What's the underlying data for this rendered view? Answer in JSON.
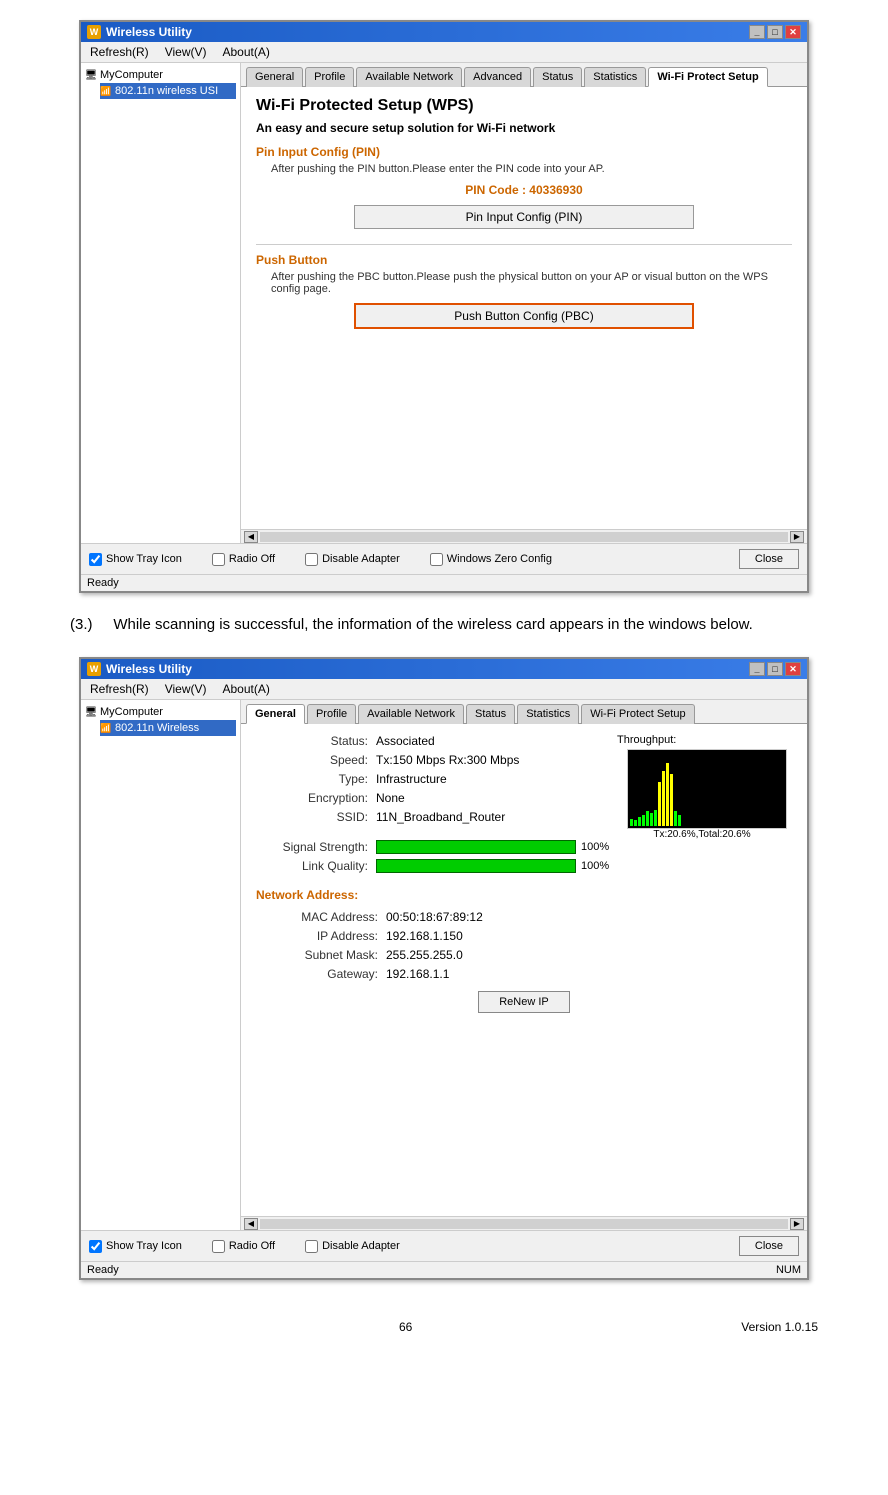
{
  "window1": {
    "title": "Wireless Utility",
    "menubar": [
      "Refresh(R)",
      "View(V)",
      "About(A)"
    ],
    "sidebar": {
      "items": [
        {
          "label": "MyComputer",
          "type": "computer"
        },
        {
          "label": "802.11n wireless USI",
          "type": "wireless"
        }
      ]
    },
    "tabs": [
      {
        "label": "General",
        "active": false
      },
      {
        "label": "Profile",
        "active": false
      },
      {
        "label": "Available Network",
        "active": false
      },
      {
        "label": "Advanced",
        "active": false
      },
      {
        "label": "Status",
        "active": false
      },
      {
        "label": "Statistics",
        "active": false
      },
      {
        "label": "Wi-Fi Protect Setup",
        "active": true
      }
    ],
    "wps": {
      "title": "Wi-Fi Protected Setup (WPS)",
      "subtitle": "An easy and secure setup solution for Wi-Fi network",
      "pin_section_title": "Pin Input Config (PIN)",
      "pin_desc": "After pushing the PIN button.Please enter the PIN code into your AP.",
      "pin_code_label": "PIN Code :  40336930",
      "pin_button": "Pin Input Config (PIN)",
      "push_section_title": "Push Button",
      "push_desc": "After pushing the PBC button.Please push the physical button on your AP or visual button on the WPS config page.",
      "push_button": "Push Button Config (PBC)"
    },
    "bottom": {
      "show_tray_icon_label": "Show Tray Icon",
      "show_tray_checked": true,
      "radio_off_label": "Radio Off",
      "radio_off_checked": false,
      "disable_adapter_label": "Disable Adapter",
      "disable_checked": false,
      "windows_zero_label": "Windows Zero Config",
      "windows_zero_checked": false,
      "close_button": "Close"
    },
    "status_bar": "Ready"
  },
  "body_text": {
    "prefix": "(3.)",
    "text": "While scanning is successful, the information of the wireless card appears in the windows below."
  },
  "window2": {
    "title": "Wireless Utility",
    "menubar": [
      "Refresh(R)",
      "View(V)",
      "About(A)"
    ],
    "sidebar": {
      "items": [
        {
          "label": "MyComputer",
          "type": "computer"
        },
        {
          "label": "802.11n Wireless",
          "type": "wireless"
        }
      ]
    },
    "tabs": [
      {
        "label": "General",
        "active": true
      },
      {
        "label": "Profile",
        "active": false
      },
      {
        "label": "Available Network",
        "active": false
      },
      {
        "label": "Status",
        "active": false
      },
      {
        "label": "Statistics",
        "active": false
      },
      {
        "label": "Wi-Fi Protect Setup",
        "active": false
      }
    ],
    "status": {
      "status_label": "Status:",
      "status_value": "Associated",
      "speed_label": "Speed:",
      "speed_value": "Tx:150 Mbps Rx:300 Mbps",
      "type_label": "Type:",
      "type_value": "Infrastructure",
      "encryption_label": "Encryption:",
      "encryption_value": "None",
      "ssid_label": "SSID:",
      "ssid_value": "11N_Broadband_Router",
      "signal_label": "Signal Strength:",
      "signal_pct": "100%",
      "link_label": "Link Quality:",
      "link_pct": "100%",
      "throughput_label": "Throughput:",
      "throughput_value": "Tx:20.6%,Total:20.6%",
      "network_section": "Network Address:",
      "mac_label": "MAC Address:",
      "mac_value": "00:50:18:67:89:12",
      "ip_label": "IP Address:",
      "ip_value": "192.168.1.150",
      "subnet_label": "Subnet Mask:",
      "subnet_value": "255.255.255.0",
      "gateway_label": "Gateway:",
      "gateway_value": "192.168.1.1",
      "renew_button": "ReNew IP"
    },
    "bottom": {
      "show_tray_icon_label": "Show Tray Icon",
      "show_tray_checked": true,
      "radio_off_label": "Radio Off",
      "radio_off_checked": false,
      "disable_adapter_label": "Disable Adapter",
      "disable_checked": false,
      "close_button": "Close"
    },
    "status_bar_left": "Ready",
    "status_bar_right": "NUM"
  },
  "footer": {
    "page_number": "66",
    "version": "Version 1.0.15"
  }
}
